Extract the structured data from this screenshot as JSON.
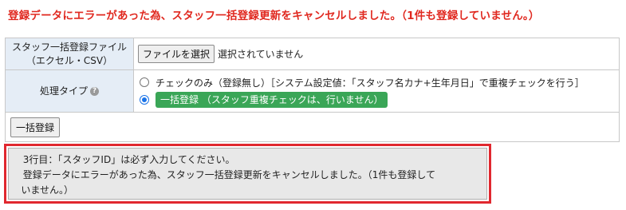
{
  "top_error": "登録データにエラーがあった為、スタッフ一括登録更新をキャンセルしました。（1件も登録していません。）",
  "form": {
    "file_label_line1": "スタッフ一括登録ファイル",
    "file_label_line2": "（エクセル・CSV）",
    "file_button": "ファイルを選択",
    "file_status": "選択されていません",
    "process_label": "処理タイプ",
    "help_icon": "question-circle-icon",
    "options": [
      {
        "label": "チェックのみ（登録無し）［システム設定値：「スタッフ名カナ+生年月日」で重複チェックを行う］",
        "checked": false
      },
      {
        "label": "一括登録 （スタッフ重複チェックは、行いません）",
        "checked": true,
        "badge_color": "#3aa657"
      }
    ],
    "submit_button": "一括登録"
  },
  "error_box": {
    "line1": "3行目：「スタッフID」は必ず入力してください。",
    "line2": "登録データにエラーがあった為、スタッフ一括登録更新をキャンセルしました。（1件も登録して",
    "line3": "いません。）",
    "border_color": "#e0282f"
  }
}
